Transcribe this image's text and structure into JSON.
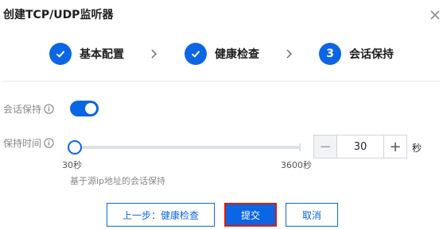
{
  "dialog": {
    "title": "创建TCP/UDP监听器",
    "close_icon": "close-icon"
  },
  "steps": [
    {
      "label": "基本配置",
      "state": "done",
      "icon": "check-icon"
    },
    {
      "label": "健康检查",
      "state": "done",
      "icon": "check-icon"
    },
    {
      "label": "会话保持",
      "state": "active",
      "number": "3"
    }
  ],
  "session": {
    "label": "会话保持",
    "enabled": true,
    "info_icon": "info-icon"
  },
  "duration": {
    "label": "保持时间",
    "info_icon": "info-icon",
    "value": "30",
    "unit": "秒",
    "min_label": "30秒",
    "max_label": "3600秒",
    "hint": "基于源ip地址的会话保持",
    "minus": "−",
    "plus": "+"
  },
  "buttons": {
    "prev": "上一步：健康检查",
    "submit": "提交",
    "cancel": "取消"
  },
  "colors": {
    "accent": "#0b66e4",
    "highlight_border": "#d81e06"
  }
}
